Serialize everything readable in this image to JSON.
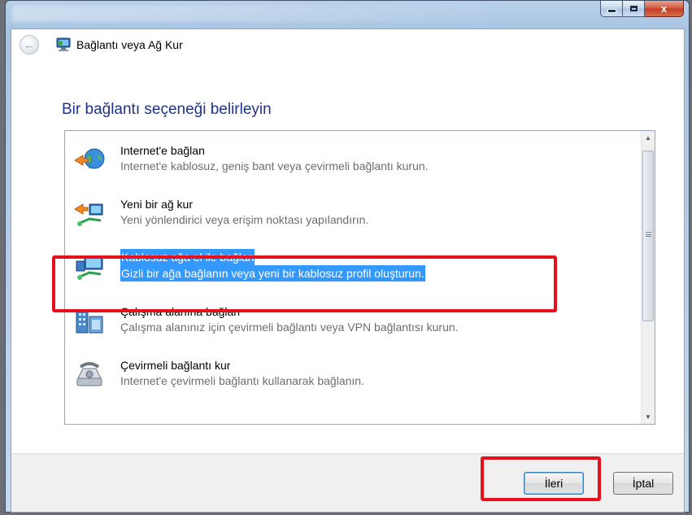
{
  "window": {
    "title": "Bağlantı veya Ağ Kur",
    "close_glyph": "x"
  },
  "heading": "Bir bağlantı seçeneği belirleyin",
  "options": [
    {
      "title": "Internet'e bağlan",
      "description": "Internet'e kablosuz, geniş bant veya çevirmeli bağlantı kurun.",
      "icon": "globe-connect-icon"
    },
    {
      "title": "Yeni bir ağ kur",
      "description": "Yeni yönlendirici veya erişim noktası yapılandırın.",
      "icon": "router-setup-icon"
    },
    {
      "title": "Kablosuz ağa el ile bağlan",
      "description": "Gizli bir ağa bağlanın veya yeni bir kablosuz profil oluşturun.",
      "icon": "wireless-network-icon",
      "selected": true
    },
    {
      "title": "Çalışma alanına bağlan",
      "description": "Çalışma alanınız için çevirmeli bağlantı veya VPN bağlantısı kurun.",
      "icon": "workplace-building-icon"
    },
    {
      "title": "Çevirmeli bağlantı kur",
      "description": "Internet'e çevirmeli bağlantı kullanarak bağlanın.",
      "icon": "dialup-phone-icon"
    }
  ],
  "buttons": {
    "next_label": "İleri",
    "cancel_label": "İptal"
  },
  "colors": {
    "heading": "#1e3287",
    "selection": "#3399ff",
    "annotation": "#e8101a"
  }
}
